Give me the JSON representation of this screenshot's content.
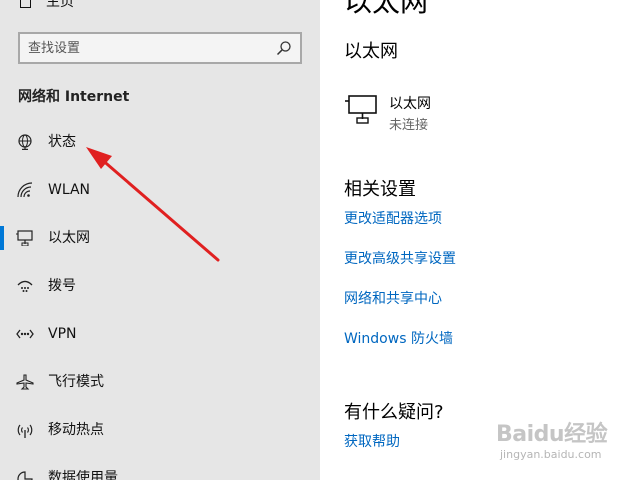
{
  "sidebar": {
    "home_label": "主页",
    "search_placeholder": "查找设置",
    "section_title": "网络和 Internet",
    "items": [
      {
        "label": "状态",
        "icon": "globe-icon"
      },
      {
        "label": "WLAN",
        "icon": "wifi-icon"
      },
      {
        "label": "以太网",
        "icon": "ethernet-icon",
        "selected": true
      },
      {
        "label": "拨号",
        "icon": "dialup-icon"
      },
      {
        "label": "VPN",
        "icon": "vpn-icon"
      },
      {
        "label": "飞行模式",
        "icon": "airplane-icon"
      },
      {
        "label": "移动热点",
        "icon": "hotspot-icon"
      },
      {
        "label": "数据使用量",
        "icon": "data-usage-icon"
      }
    ]
  },
  "main": {
    "page_title": "以太网",
    "subtitle": "以太网",
    "network": {
      "name": "以太网",
      "status": "未连接"
    },
    "related_title": "相关设置",
    "related_links": [
      "更改适配器选项",
      "更改高级共享设置",
      "网络和共享中心",
      "Windows 防火墙"
    ],
    "faq_title": "有什么疑问?",
    "faq_link": "获取帮助"
  },
  "watermark": {
    "text": "Baidu经验",
    "sub": "jingyan.baidu.com"
  },
  "colors": {
    "accent": "#0078d7",
    "link": "#0067c0",
    "arrow": "#e02020",
    "sidebar_bg": "#e6e6e6"
  }
}
